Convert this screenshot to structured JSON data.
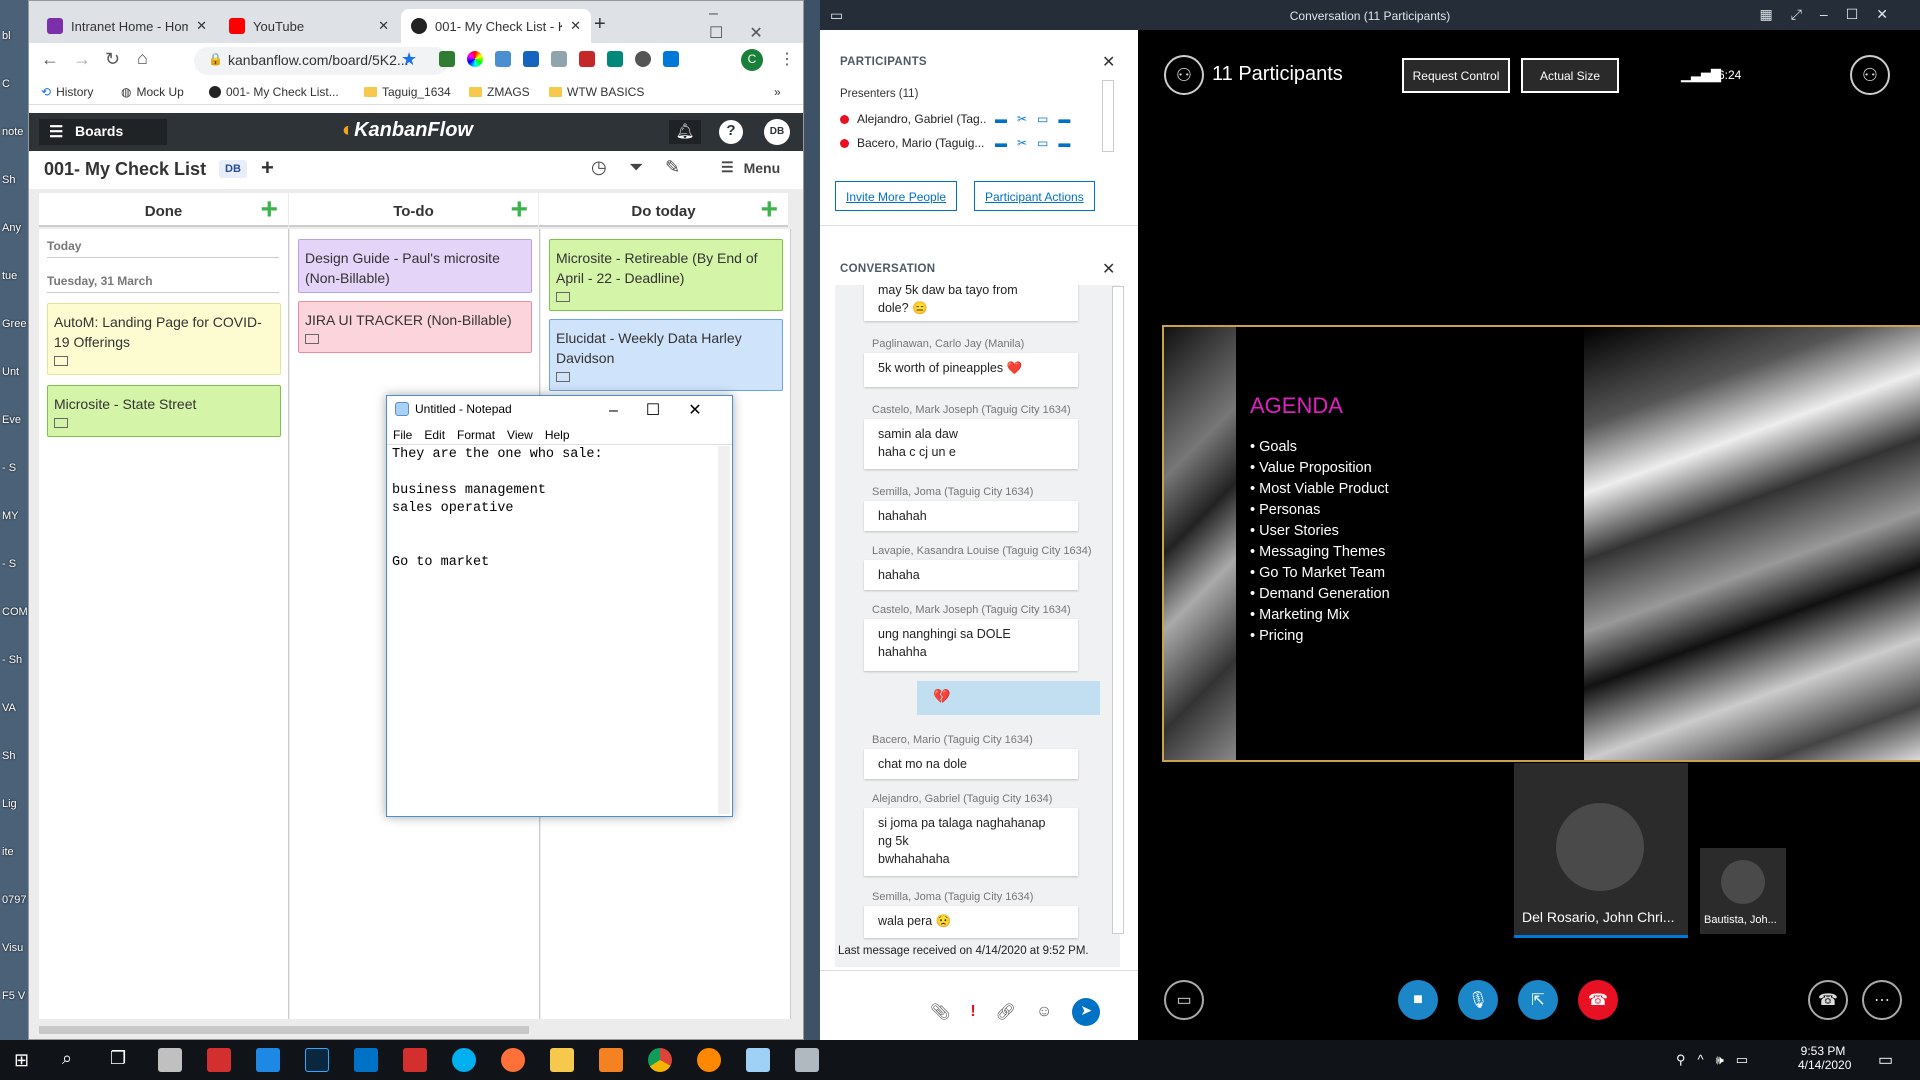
{
  "desktop": {
    "labels": [
      "bl",
      "C",
      "note",
      "Sh",
      "Any",
      "tue",
      "Gree",
      "Unt",
      "Eve",
      "- S",
      "MY",
      "- S",
      "COM",
      "- Sh",
      "VA",
      "Sh",
      "Lig",
      "ite",
      "0797",
      "Visu",
      "F5 V"
    ]
  },
  "browser": {
    "tabs": [
      {
        "title": "Intranet Home - Home",
        "color": "#7b2fa8"
      },
      {
        "title": "YouTube",
        "color": "#ff0000"
      },
      {
        "title": "001- My Check List - K",
        "color": "#222222"
      }
    ],
    "url": "kanbanflow.com/board/5K2...",
    "bookmarks": [
      "History",
      "Mock Up",
      "001- My Check List...",
      "Taguig_1634",
      "ZMAGS",
      "WTW BASICS"
    ],
    "profile_initial": "C"
  },
  "kanban": {
    "boards_label": "Boards",
    "logo": "KanbanFlow",
    "user_initials": "DB",
    "board_title": "001- My Check List",
    "board_badge": "DB",
    "menu_label": "Menu",
    "columns": [
      {
        "name": "Done"
      },
      {
        "name": "To-do"
      },
      {
        "name": "Do today"
      }
    ],
    "done_today": "Today",
    "done_date": "Tuesday, 31 March",
    "done_cards": [
      "AutoM: Landing Page for COVID-19 Offerings",
      "Microsite - State Street"
    ],
    "todo_cards": [
      "Design Guide - Paul's microsite (Non-Billable)",
      "JIRA UI TRACKER (Non-Billable)"
    ],
    "today_cards": [
      "Microsite - Retireable (By End of April - 22 - Deadline)",
      "Elucidat - Weekly Data Harley Davidson"
    ],
    "colors": {
      "yellow": "#fdfbd0",
      "green": "#d4f4a8",
      "purple": "#e4d4f8",
      "pink": "#fcd4dc",
      "blue": "#cfe3fb"
    }
  },
  "notepad": {
    "title": "Untitled - Notepad",
    "menu": [
      "File",
      "Edit",
      "Format",
      "View",
      "Help"
    ],
    "text": "They are the one who sale:\n\nbusiness management\nsales operative\n\n\nGo to market"
  },
  "skype": {
    "window_title": "Conversation (11 Participants)",
    "participants_header": "PARTICIPANTS",
    "presenters_label": "Presenters (11)",
    "participants": [
      "Alejandro, Gabriel (Tag...",
      "Bacero, Mario (Taguig..."
    ],
    "invite_label": "Invite More People",
    "actions_label": "Participant Actions",
    "conversation_header": "CONVERSATION",
    "messages": [
      {
        "sender": "",
        "lines": [
          "may 5k daw ba tayo from",
          "dole? 😑"
        ]
      },
      {
        "sender": "Paglinawan, Carlo Jay (Manila)",
        "lines": [
          "5k worth of pineapples ❤️"
        ]
      },
      {
        "sender": "Castelo, Mark Joseph (Taguig City 1634)",
        "lines": [
          "samin ala daw",
          "haha c cj un e"
        ]
      },
      {
        "sender": "Semilla, Joma (Taguig City 1634)",
        "lines": [
          "hahahah"
        ]
      },
      {
        "sender": "Lavapie, Kasandra Louise (Taguig City 1634)",
        "lines": [
          "hahaha"
        ]
      },
      {
        "sender": "Castelo, Mark Joseph (Taguig City 1634)",
        "lines": [
          "ung nanghingi sa DOLE",
          "hahahha"
        ]
      },
      {
        "sender": "Bacero, Mario (Taguig City 1634)",
        "lines": [
          "chat mo na dole"
        ]
      },
      {
        "sender": "Alejandro, Gabriel (Taguig City 1634)",
        "lines": [
          "si joma pa talaga naghahanap",
          "ng 5k",
          "bwhahahaha"
        ]
      },
      {
        "sender": "Semilla, Joma (Taguig City 1634)",
        "lines": [
          "wala pera 😟"
        ]
      }
    ],
    "own_message": "💔",
    "last_received": "Last message received on 4/14/2020 at 9:52 PM.",
    "participants_count": "11 Participants",
    "request_control": "Request Control",
    "actual_size": "Actual Size",
    "call_time": "6:24",
    "agenda_title": "AGENDA",
    "agenda_items": [
      "Goals",
      "Value Proposition",
      "Most Viable Product",
      "Personas",
      "User Stories",
      "Messaging Themes",
      "Go To Market Team",
      "Demand Generation",
      "Marketing Mix",
      "Pricing"
    ],
    "agenda_color": "#e020c0",
    "video_main": "Del Rosario, John Chri...",
    "video_small": "Bautista, Joh..."
  },
  "taskbar": {
    "time": "9:53 PM",
    "date": "4/14/2020"
  }
}
